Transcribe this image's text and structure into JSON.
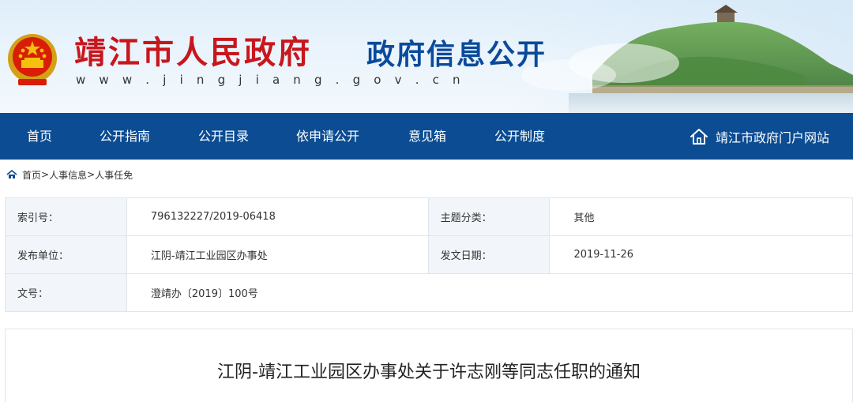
{
  "header": {
    "site_title": "靖江市人民政府",
    "site_url": "w w w . j i n g j i a n g . g o v . c n",
    "section_title": "政府信息公开"
  },
  "nav": {
    "items": [
      {
        "label": "首页"
      },
      {
        "label": "公开指南"
      },
      {
        "label": "公开目录"
      },
      {
        "label": "依申请公开"
      },
      {
        "label": "意见箱"
      },
      {
        "label": "公开制度"
      }
    ],
    "portal_label": "靖江市政府门户网站"
  },
  "breadcrumb": {
    "items": [
      "首页",
      "人事信息",
      "人事任免"
    ],
    "separator": ">"
  },
  "meta": {
    "index_label": "索引号：",
    "index_value": "796132227/2019-06418",
    "topic_label": "主题分类：",
    "topic_value": "其他",
    "publisher_label": "发布单位：",
    "publisher_value": "江阴-靖江工业园区办事处",
    "date_label": "发文日期：",
    "date_value": "2019-11-26",
    "docno_label": "文号：",
    "docno_value": "澄靖办〔2019〕100号"
  },
  "article": {
    "title": "江阴-靖江工业园区办事处关于许志刚等同志任职的通知"
  },
  "colors": {
    "nav_bg": "#0b4c92",
    "site_title": "#c8161d",
    "section_title": "#0a4a9a",
    "label_bg": "#f2f6fb",
    "border": "#dfe5ec"
  },
  "icons": {
    "emblem": "national-emblem-icon",
    "portal": "home-icon",
    "breadcrumb": "home-icon"
  }
}
